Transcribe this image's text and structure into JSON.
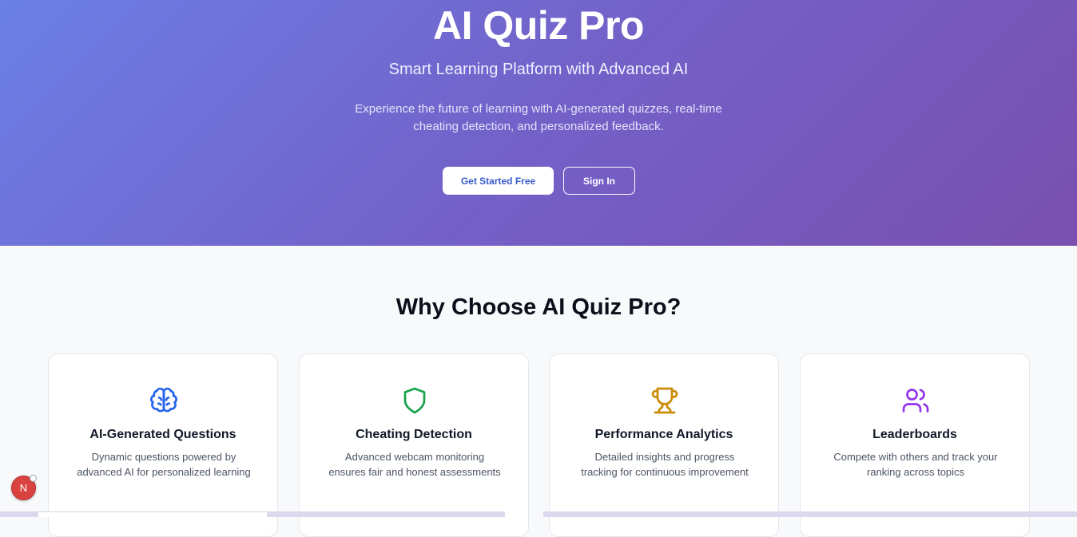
{
  "hero": {
    "title": "AI Quiz Pro",
    "subtitle": "Smart Learning Platform with Advanced AI",
    "description": "Experience the future of learning with AI-generated quizzes, real-time cheating detection, and personalized feedback.",
    "primary_button": "Get Started Free",
    "secondary_button": "Sign In"
  },
  "features": {
    "title": "Why Choose AI Quiz Pro?",
    "cards": [
      {
        "icon": "brain-icon",
        "color": "#2563eb",
        "title": "AI-Generated Questions",
        "description": "Dynamic questions powered by advanced AI for personalized learning"
      },
      {
        "icon": "shield-icon",
        "color": "#16a34a",
        "title": "Cheating Detection",
        "description": "Advanced webcam monitoring ensures fair and honest assessments"
      },
      {
        "icon": "trophy-icon",
        "color": "#ca8a04",
        "title": "Performance Analytics",
        "description": "Detailed insights and progress tracking for continuous improvement"
      },
      {
        "icon": "users-icon",
        "color": "#9333ea",
        "title": "Leaderboards",
        "description": "Compete with others and track your ranking across topics"
      }
    ]
  },
  "badge": {
    "letter": "N"
  },
  "colors": {
    "hero_gradient_start": "#6b7fe6",
    "hero_gradient_end": "#7a4fb0",
    "primary_button_text": "#3b5bcc"
  }
}
